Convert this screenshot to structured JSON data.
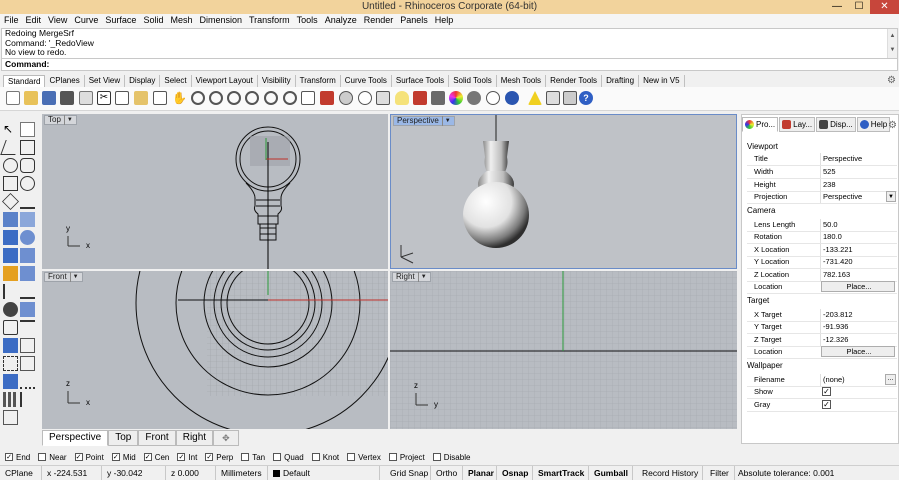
{
  "window": {
    "title": "Untitled - Rhinoceros Corporate (64-bit)"
  },
  "menu": [
    "File",
    "Edit",
    "View",
    "Curve",
    "Surface",
    "Solid",
    "Mesh",
    "Dimension",
    "Transform",
    "Tools",
    "Analyze",
    "Render",
    "Panels",
    "Help"
  ],
  "command_history": [
    "Redoing MergeSrf",
    "Command: '_RedoView",
    "No view to redo."
  ],
  "command_prompt": "Command:",
  "toolbar_tabs": [
    "Standard",
    "CPlanes",
    "Set View",
    "Display",
    "Select",
    "Viewport Layout",
    "Visibility",
    "Transform",
    "Curve Tools",
    "Surface Tools",
    "Solid Tools",
    "Mesh Tools",
    "Render Tools",
    "Drafting",
    "New in V5"
  ],
  "viewports": {
    "top": {
      "label": "Top"
    },
    "perspective": {
      "label": "Perspective"
    },
    "front": {
      "label": "Front"
    },
    "right": {
      "label": "Right"
    },
    "axes": {
      "x": "x",
      "y": "y",
      "z": "z"
    }
  },
  "viewport_tabs": [
    "Perspective",
    "Top",
    "Front",
    "Right"
  ],
  "panel": {
    "tabs": [
      "Pro...",
      "Lay...",
      "Disp...",
      "Help"
    ],
    "viewport_section": "Viewport",
    "viewport_rows": [
      {
        "k": "Title",
        "v": "Perspective"
      },
      {
        "k": "Width",
        "v": "525"
      },
      {
        "k": "Height",
        "v": "238"
      },
      {
        "k": "Projection",
        "v": "Perspective"
      }
    ],
    "camera_section": "Camera",
    "camera_rows": [
      {
        "k": "Lens Length",
        "v": "50.0"
      },
      {
        "k": "Rotation",
        "v": "180.0"
      },
      {
        "k": "X Location",
        "v": "-133.221"
      },
      {
        "k": "Y Location",
        "v": "-731.420"
      },
      {
        "k": "Z Location",
        "v": "782.163"
      },
      {
        "k": "Location",
        "v": "Place..."
      }
    ],
    "target_section": "Target",
    "target_rows": [
      {
        "k": "X Target",
        "v": "-203.812"
      },
      {
        "k": "Y Target",
        "v": "-91.936"
      },
      {
        "k": "Z Target",
        "v": "-12.326"
      },
      {
        "k": "Location",
        "v": "Place..."
      }
    ],
    "wallpaper_section": "Wallpaper",
    "wallpaper_rows": [
      {
        "k": "Filename",
        "v": "(none)"
      },
      {
        "k": "Show",
        "v": "✓"
      },
      {
        "k": "Gray",
        "v": "✓"
      }
    ]
  },
  "osnaps": [
    {
      "label": "End",
      "checked": "✓"
    },
    {
      "label": "Near",
      "checked": ""
    },
    {
      "label": "Point",
      "checked": "✓"
    },
    {
      "label": "Mid",
      "checked": "✓"
    },
    {
      "label": "Cen",
      "checked": "✓"
    },
    {
      "label": "Int",
      "checked": "✓"
    },
    {
      "label": "Perp",
      "checked": "✓"
    },
    {
      "label": "Tan",
      "checked": ""
    },
    {
      "label": "Quad",
      "checked": ""
    },
    {
      "label": "Knot",
      "checked": ""
    },
    {
      "label": "Vertex",
      "checked": ""
    },
    {
      "label": "Project",
      "checked": ""
    },
    {
      "label": "Disable",
      "checked": ""
    }
  ],
  "status": {
    "cplane": "CPlane",
    "x": "x -224.531",
    "y": "y -30.042",
    "z": "z 0.000",
    "units": "Millimeters",
    "layer": "Default",
    "grid_snap": "Grid Snap",
    "ortho": "Ortho",
    "planar": "Planar",
    "osnap": "Osnap",
    "smarttrack": "SmartTrack",
    "gumball": "Gumball",
    "record_history": "Record History",
    "filter": "Filter",
    "tolerance": "Absolute tolerance: 0.001"
  },
  "icons": {
    "minimize": "minimize-icon",
    "maximize": "maximize-icon",
    "close": "close-icon",
    "gear": "gear-icon"
  },
  "colors": {
    "titlebar": "#f2d39c",
    "close": "#c7463b",
    "viewport_bg": "#b8bcc2",
    "active_label": "#9bb8e6"
  }
}
